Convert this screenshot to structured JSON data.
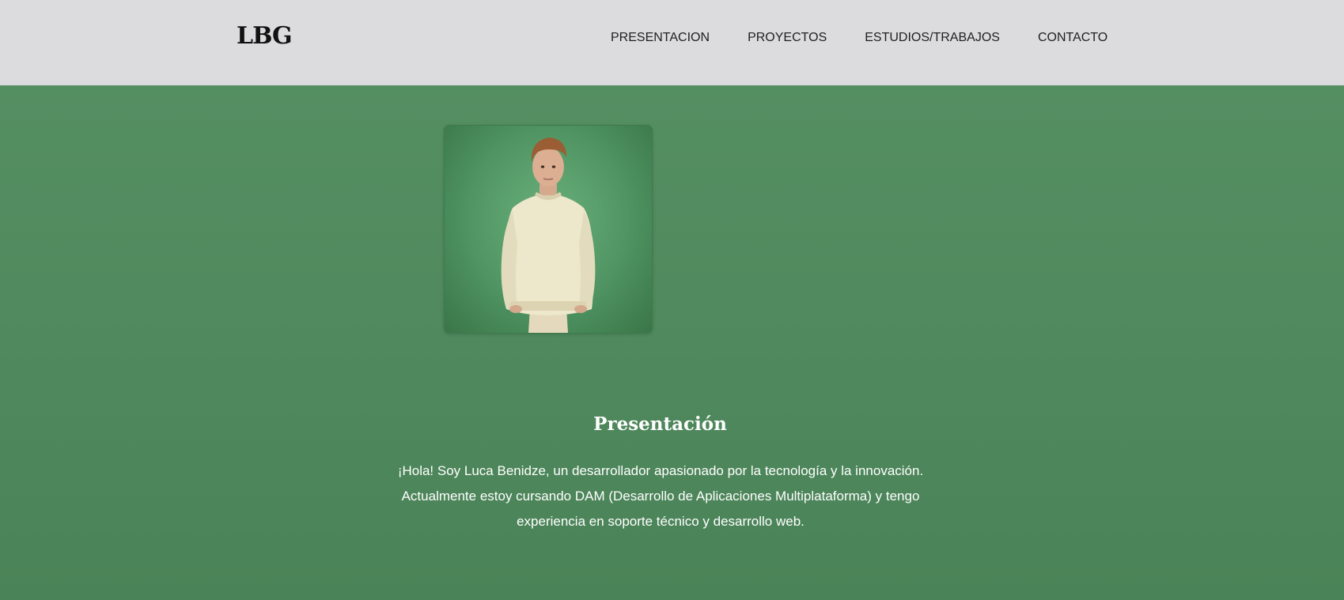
{
  "header": {
    "logo": "LBG",
    "nav": [
      {
        "label": "PRESENTACION"
      },
      {
        "label": "PROYECTOS"
      },
      {
        "label": "ESTUDIOS/TRABAJOS"
      },
      {
        "label": "CONTACTO"
      }
    ]
  },
  "presentation": {
    "title": "Presentación",
    "text_lines": [
      "¡Hola! Soy Luca Benidze, un desarrollador apasionado por la tecnología y la innovación.",
      "Actualmente estoy cursando DAM (Desarrollo de Aplicaciones Multiplataforma) y tengo",
      "experiencia en soporte técnico y desarrollo web."
    ]
  },
  "colors": {
    "header_bg": "#dcdcde",
    "page_bg": "#4f8a5d",
    "text_light": "#ffffff",
    "text_dark": "#121212"
  },
  "icons": {
    "profile_photo": "person-portrait-icon"
  }
}
